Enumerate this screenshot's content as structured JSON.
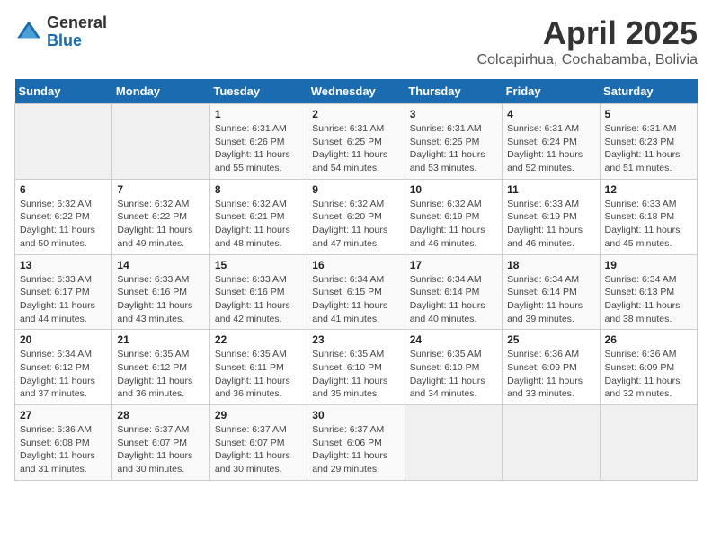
{
  "header": {
    "logo_general": "General",
    "logo_blue": "Blue",
    "title": "April 2025",
    "location": "Colcapirhua, Cochabamba, Bolivia"
  },
  "weekdays": [
    "Sunday",
    "Monday",
    "Tuesday",
    "Wednesday",
    "Thursday",
    "Friday",
    "Saturday"
  ],
  "weeks": [
    [
      null,
      null,
      {
        "day": 1,
        "sunrise": "6:31 AM",
        "sunset": "6:26 PM",
        "daylight": "11 hours and 55 minutes."
      },
      {
        "day": 2,
        "sunrise": "6:31 AM",
        "sunset": "6:25 PM",
        "daylight": "11 hours and 54 minutes."
      },
      {
        "day": 3,
        "sunrise": "6:31 AM",
        "sunset": "6:25 PM",
        "daylight": "11 hours and 53 minutes."
      },
      {
        "day": 4,
        "sunrise": "6:31 AM",
        "sunset": "6:24 PM",
        "daylight": "11 hours and 52 minutes."
      },
      {
        "day": 5,
        "sunrise": "6:31 AM",
        "sunset": "6:23 PM",
        "daylight": "11 hours and 51 minutes."
      }
    ],
    [
      {
        "day": 6,
        "sunrise": "6:32 AM",
        "sunset": "6:22 PM",
        "daylight": "11 hours and 50 minutes."
      },
      {
        "day": 7,
        "sunrise": "6:32 AM",
        "sunset": "6:22 PM",
        "daylight": "11 hours and 49 minutes."
      },
      {
        "day": 8,
        "sunrise": "6:32 AM",
        "sunset": "6:21 PM",
        "daylight": "11 hours and 48 minutes."
      },
      {
        "day": 9,
        "sunrise": "6:32 AM",
        "sunset": "6:20 PM",
        "daylight": "11 hours and 47 minutes."
      },
      {
        "day": 10,
        "sunrise": "6:32 AM",
        "sunset": "6:19 PM",
        "daylight": "11 hours and 46 minutes."
      },
      {
        "day": 11,
        "sunrise": "6:33 AM",
        "sunset": "6:19 PM",
        "daylight": "11 hours and 46 minutes."
      },
      {
        "day": 12,
        "sunrise": "6:33 AM",
        "sunset": "6:18 PM",
        "daylight": "11 hours and 45 minutes."
      }
    ],
    [
      {
        "day": 13,
        "sunrise": "6:33 AM",
        "sunset": "6:17 PM",
        "daylight": "11 hours and 44 minutes."
      },
      {
        "day": 14,
        "sunrise": "6:33 AM",
        "sunset": "6:16 PM",
        "daylight": "11 hours and 43 minutes."
      },
      {
        "day": 15,
        "sunrise": "6:33 AM",
        "sunset": "6:16 PM",
        "daylight": "11 hours and 42 minutes."
      },
      {
        "day": 16,
        "sunrise": "6:34 AM",
        "sunset": "6:15 PM",
        "daylight": "11 hours and 41 minutes."
      },
      {
        "day": 17,
        "sunrise": "6:34 AM",
        "sunset": "6:14 PM",
        "daylight": "11 hours and 40 minutes."
      },
      {
        "day": 18,
        "sunrise": "6:34 AM",
        "sunset": "6:14 PM",
        "daylight": "11 hours and 39 minutes."
      },
      {
        "day": 19,
        "sunrise": "6:34 AM",
        "sunset": "6:13 PM",
        "daylight": "11 hours and 38 minutes."
      }
    ],
    [
      {
        "day": 20,
        "sunrise": "6:34 AM",
        "sunset": "6:12 PM",
        "daylight": "11 hours and 37 minutes."
      },
      {
        "day": 21,
        "sunrise": "6:35 AM",
        "sunset": "6:12 PM",
        "daylight": "11 hours and 36 minutes."
      },
      {
        "day": 22,
        "sunrise": "6:35 AM",
        "sunset": "6:11 PM",
        "daylight": "11 hours and 36 minutes."
      },
      {
        "day": 23,
        "sunrise": "6:35 AM",
        "sunset": "6:10 PM",
        "daylight": "11 hours and 35 minutes."
      },
      {
        "day": 24,
        "sunrise": "6:35 AM",
        "sunset": "6:10 PM",
        "daylight": "11 hours and 34 minutes."
      },
      {
        "day": 25,
        "sunrise": "6:36 AM",
        "sunset": "6:09 PM",
        "daylight": "11 hours and 33 minutes."
      },
      {
        "day": 26,
        "sunrise": "6:36 AM",
        "sunset": "6:09 PM",
        "daylight": "11 hours and 32 minutes."
      }
    ],
    [
      {
        "day": 27,
        "sunrise": "6:36 AM",
        "sunset": "6:08 PM",
        "daylight": "11 hours and 31 minutes."
      },
      {
        "day": 28,
        "sunrise": "6:37 AM",
        "sunset": "6:07 PM",
        "daylight": "11 hours and 30 minutes."
      },
      {
        "day": 29,
        "sunrise": "6:37 AM",
        "sunset": "6:07 PM",
        "daylight": "11 hours and 30 minutes."
      },
      {
        "day": 30,
        "sunrise": "6:37 AM",
        "sunset": "6:06 PM",
        "daylight": "11 hours and 29 minutes."
      },
      null,
      null,
      null
    ]
  ]
}
